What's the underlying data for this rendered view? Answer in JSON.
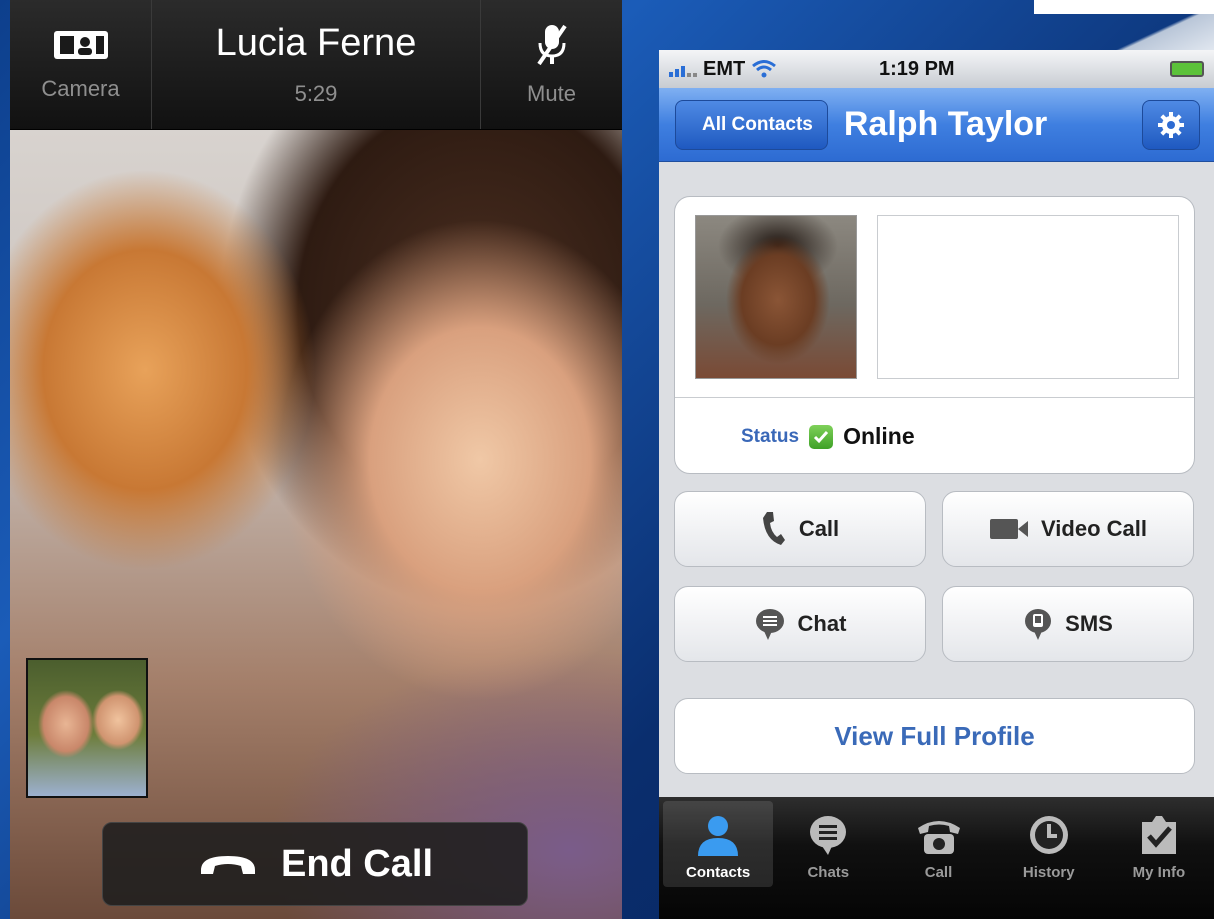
{
  "video_call": {
    "contact_name": "Lucia Ferne",
    "timer": "5:29",
    "camera_label": "Camera",
    "mute_label": "Mute",
    "end_call_label": "End Call",
    "icons": [
      "camera-switch-icon",
      "mic-muted-icon",
      "phone-hangup-icon"
    ]
  },
  "contact_app": {
    "status_bar": {
      "carrier": "EMT",
      "time": "1:19 PM",
      "icons": [
        "signal-icon",
        "wifi-icon",
        "battery-icon"
      ]
    },
    "nav": {
      "back_label": "All Contacts",
      "title": "Ralph Taylor",
      "settings_icon": "gear-icon"
    },
    "profile": {
      "status_label": "Status",
      "status_value": "Online"
    },
    "actions": {
      "call": "Call",
      "video_call": "Video Call",
      "chat": "Chat",
      "sms": "SMS"
    },
    "view_profile": "View Full Profile",
    "tabs": [
      {
        "label": "Contacts",
        "icon": "person-icon",
        "active": true
      },
      {
        "label": "Chats",
        "icon": "chat-bubble-icon",
        "active": false
      },
      {
        "label": "Call",
        "icon": "telephone-icon",
        "active": false
      },
      {
        "label": "History",
        "icon": "clock-icon",
        "active": false
      },
      {
        "label": "My Info",
        "icon": "checkmark-icon",
        "active": false
      }
    ],
    "colors": {
      "nav_blue": "#3f7fe0",
      "online_green": "#3ea126",
      "link_blue": "#3a6ab8"
    }
  }
}
